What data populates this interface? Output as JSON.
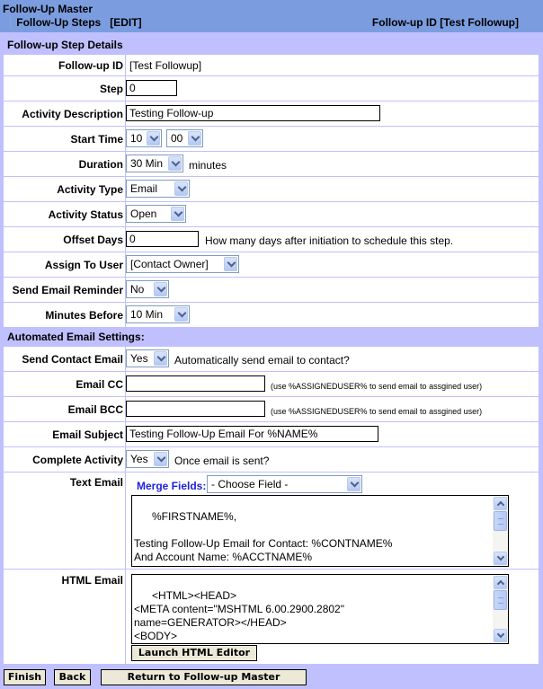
{
  "header": {
    "title": "Follow-Up Master",
    "breadcrumb": "Follow-Up Steps",
    "mode": "[EDIT]",
    "followup_id_label": "Follow-up ID [Test Followup]"
  },
  "step_details": {
    "section_title": "Follow-up Step Details",
    "followup_id": {
      "label": "Follow-up ID",
      "value": "[Test Followup]"
    },
    "step": {
      "label": "Step",
      "value": "0"
    },
    "activity_description": {
      "label": "Activity Description",
      "value": "Testing Follow-up"
    },
    "start_time": {
      "label": "Start Time",
      "hour": "10",
      "minute": "00"
    },
    "duration": {
      "label": "Duration",
      "value": "30 Min",
      "suffix": "minutes"
    },
    "activity_type": {
      "label": "Activity Type",
      "value": "Email"
    },
    "activity_status": {
      "label": "Activity Status",
      "value": "Open"
    },
    "offset_days": {
      "label": "Offset Days",
      "value": "0",
      "hint": "How many days after initiation to schedule this step."
    },
    "assign_to_user": {
      "label": "Assign To User",
      "value": "[Contact Owner]"
    },
    "send_email_reminder": {
      "label": "Send Email Reminder",
      "value": "No"
    },
    "minutes_before": {
      "label": "Minutes Before",
      "value": "10 Min"
    }
  },
  "email_settings": {
    "section_title": "Automated Email Settings:",
    "send_contact_email": {
      "label": "Send Contact Email",
      "value": "Yes",
      "hint": "Automatically send email to contact?"
    },
    "email_cc": {
      "label": "Email CC",
      "value": "",
      "hint": "(use %ASSIGNEDUSER% to send email to assgined user)"
    },
    "email_bcc": {
      "label": "Email BCC",
      "value": "",
      "hint": "(use %ASSIGNEDUSER% to send email to assgined user)"
    },
    "email_subject": {
      "label": "Email Subject",
      "value": "Testing Follow-Up Email For %NAME%"
    },
    "complete_activity": {
      "label": "Complete Activity",
      "value": "Yes",
      "hint": "Once email is sent?"
    },
    "text_email": {
      "label": "Text Email",
      "merge_label": "Merge Fields:",
      "merge_value": "- Choose Field -",
      "body": "%FIRSTNAME%,\n\nTesting Follow-Up Email for Contact: %CONTNAME%\nAnd Account Name: %ACCTNAME%"
    },
    "html_email": {
      "label": "HTML Email",
      "body": "<HTML><HEAD>\n<META content=\"MSHTML 6.00.2900.2802\"\nname=GENERATOR></HEAD>\n<BODY>\n<P>%FIRSTNAME%, </P>",
      "launch_button": "Launch HTML Editor"
    }
  },
  "footer": {
    "finish": "Finish",
    "back": "Back",
    "return": "Return to Follow-up Master"
  }
}
